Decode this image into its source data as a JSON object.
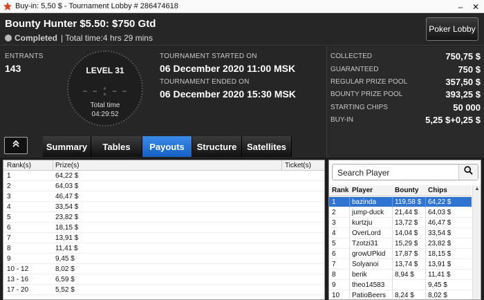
{
  "window": {
    "title": "Buy-in: 5,50 $ - Tournament Lobby # 286474618",
    "controls": [
      "–",
      "✕"
    ]
  },
  "header": {
    "tournament_name": "Bounty Hunter $5.50: $750 Gtd",
    "status": "Completed",
    "total_time": "| Total time:4 hrs  29 mins",
    "poker_lobby_button": "Poker Lobby"
  },
  "info": {
    "entrants_label": "ENTRANTS",
    "entrants_value": "143",
    "level": "LEVEL 31",
    "clock_digits": "--:--",
    "total_time_label": "Total time",
    "total_time_value": "04:29:52",
    "started_label": "TOURNAMENT STARTED ON",
    "started_value": "06 December 2020  11:00 MSK",
    "ended_label": "TOURNAMENT ENDED ON",
    "ended_value": "06 December 2020  15:30 MSK"
  },
  "summary": [
    {
      "key": "COLLECTED",
      "value": "750,75 $"
    },
    {
      "key": "GUARANTEED",
      "value": "750 $"
    },
    {
      "key": "REGULAR PRIZE POOL",
      "value": "357,50 $"
    },
    {
      "key": "BOUNTY PRIZE POOL",
      "value": "393,25 $"
    },
    {
      "key": "STARTING CHIPS",
      "value": "50 000"
    },
    {
      "key": "BUY-IN",
      "value": "5,25 $+0,25 $"
    }
  ],
  "tabs": [
    {
      "label": "Summary",
      "active": false
    },
    {
      "label": "Tables",
      "active": false
    },
    {
      "label": "Payouts",
      "active": true
    },
    {
      "label": "Structure",
      "active": false
    },
    {
      "label": "Satellites",
      "active": false
    }
  ],
  "payouts": {
    "headers": {
      "rank": "Rank(s)",
      "prize": "Prize(s)",
      "ticket": "Ticket(s)"
    },
    "rows": [
      {
        "rank": "1",
        "prize": "64,22 $"
      },
      {
        "rank": "2",
        "prize": "64,03 $"
      },
      {
        "rank": "3",
        "prize": "46,47 $"
      },
      {
        "rank": "4",
        "prize": "33,54 $"
      },
      {
        "rank": "5",
        "prize": "23,82 $"
      },
      {
        "rank": "6",
        "prize": "18,15 $"
      },
      {
        "rank": "7",
        "prize": "13,91 $"
      },
      {
        "rank": "8",
        "prize": "11,41 $"
      },
      {
        "rank": "9",
        "prize": "9,45 $"
      },
      {
        "rank": "10 - 12",
        "prize": "8,02 $"
      },
      {
        "rank": "13 - 16",
        "prize": "6,59 $"
      },
      {
        "rank": "17 - 20",
        "prize": "5,52 $"
      }
    ]
  },
  "players": {
    "search_placeholder": "Search Player",
    "headers": {
      "rank": "Rank",
      "player": "Player",
      "bounty": "Bounty",
      "chips": "Chips"
    },
    "rows": [
      {
        "rank": "1",
        "player": "bazinda",
        "bounty": "119,58 $",
        "chips": "64,22 $",
        "selected": true
      },
      {
        "rank": "2",
        "player": "jump-duck",
        "bounty": "21,44 $",
        "chips": "64,03 $"
      },
      {
        "rank": "3",
        "player": "kurtzju",
        "bounty": "13,72 $",
        "chips": "46,47 $"
      },
      {
        "rank": "4",
        "player": "OverLord",
        "bounty": "14,04 $",
        "chips": "33,54 $"
      },
      {
        "rank": "5",
        "player": "Tzotzi31",
        "bounty": "15,29 $",
        "chips": "23,82 $"
      },
      {
        "rank": "6",
        "player": "growUPkid",
        "bounty": "17,87 $",
        "chips": "18,15 $"
      },
      {
        "rank": "7",
        "player": "Solyanoi",
        "bounty": "13,74 $",
        "chips": "13,91 $"
      },
      {
        "rank": "8",
        "player": "berik",
        "bounty": "8,94 $",
        "chips": "11,41 $"
      },
      {
        "rank": "9",
        "player": "theo14583",
        "bounty": "",
        "chips": "9,45 $"
      },
      {
        "rank": "10",
        "player": "PatioBeers",
        "bounty": "8,24 $",
        "chips": "8,02 $"
      }
    ]
  },
  "colors": {
    "accent": "#1f6fd6",
    "background": "#262626",
    "selected_row": "#2f74d0"
  }
}
